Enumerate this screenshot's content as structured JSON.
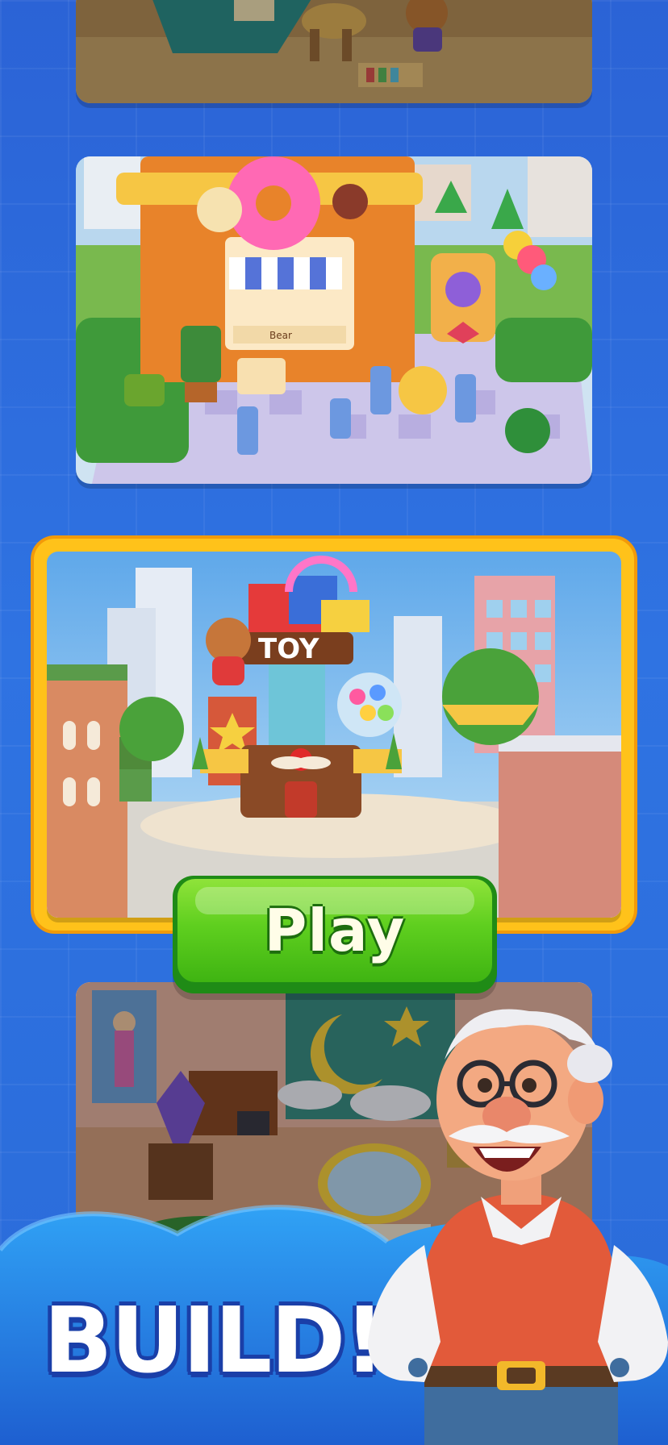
{
  "play_button": {
    "label": "Play"
  },
  "banner": {
    "title": "BUILD!"
  },
  "scenes": {
    "cafe_sign": "Bear",
    "toy_store_sign": "TOY"
  },
  "colors": {
    "background": "#2f73e2",
    "play_button": "#5fcf1f",
    "selected_frame": "#ffc21a",
    "banner_text": "#ffffff",
    "cloud": "#2a86ee"
  }
}
